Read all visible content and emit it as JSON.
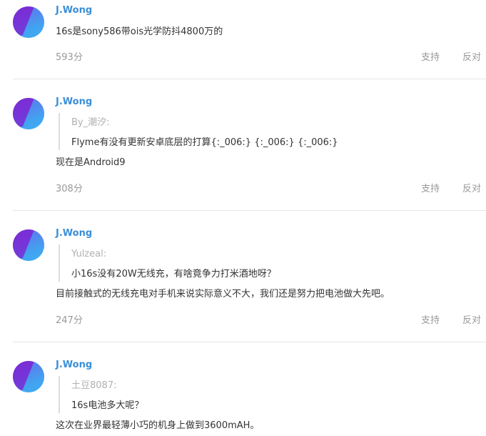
{
  "actions": {
    "support": "支持",
    "oppose": "反对"
  },
  "colors": {
    "username": "#3a8fd8",
    "muted": "#999999",
    "quote_author": "#b0b0b0",
    "divider": "#e6e6e6"
  },
  "comments": [
    {
      "user": "J.Wong",
      "content": "16s是sony586带ois光学防抖4800万的",
      "score": "593分"
    },
    {
      "user": "J.Wong",
      "quote_author": "By_潮汐:",
      "quote_text": "Flyme有没有更新安卓底层的打算{:_006:} {:_006:} {:_006:}",
      "content": "现在是Android9",
      "score": "308分"
    },
    {
      "user": "J.Wong",
      "quote_author": "Yulzeal:",
      "quote_text": "小16s没有20W无线充，有啥竟争力打米酒地呀？",
      "content": "目前接触式的无线充电对手机来说实际意义不大，我们还是努力把电池做大先吧。",
      "score": "247分"
    },
    {
      "user": "J.Wong",
      "quote_author": "土豆8087:",
      "quote_text": "16s电池多大呢？",
      "content": "这次在业界最轻薄小巧的机身上做到3600mAH。"
    }
  ]
}
